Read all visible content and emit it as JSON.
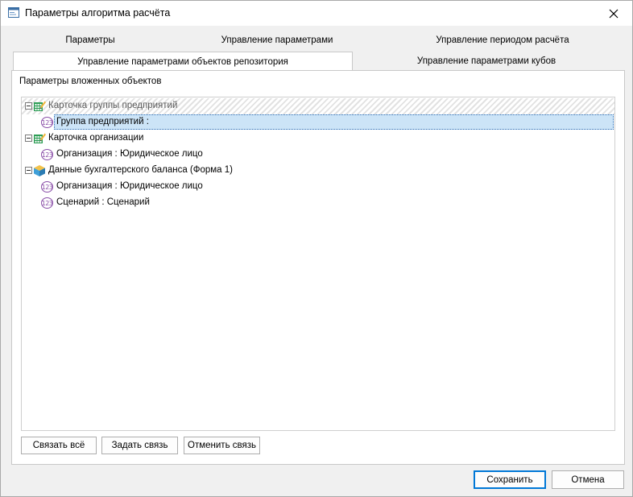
{
  "window": {
    "title": "Параметры алгоритма расчёта"
  },
  "tabs": {
    "row1": [
      {
        "label": "Параметры"
      },
      {
        "label": "Управление параметрами"
      },
      {
        "label": "Управление периодом расчёта"
      }
    ],
    "row2": [
      {
        "label": "Управление параметрами объектов репозитория",
        "active": true
      },
      {
        "label": "Управление параметрами кубов",
        "active": false
      }
    ]
  },
  "panel": {
    "group_label": "Параметры вложенных объектов"
  },
  "tree": {
    "nodes": [
      {
        "label": "Карточка группы предприятий",
        "type": "group",
        "icon": "dictionary-icon",
        "expanded": true,
        "muted": true
      },
      {
        "label": "Группа предприятий :",
        "type": "param",
        "icon": "param-123-icon",
        "selected": true
      },
      {
        "label": "Карточка организации",
        "type": "group",
        "icon": "dictionary-icon",
        "expanded": true
      },
      {
        "label": "Организация : Юридическое лицо",
        "type": "param",
        "icon": "param-123-icon"
      },
      {
        "label": "Данные бухгалтерского баланса (Форма 1)",
        "type": "group",
        "icon": "cube-icon",
        "expanded": true
      },
      {
        "label": "Организация : Юридическое лицо",
        "type": "param",
        "icon": "param-123-icon"
      },
      {
        "label": "Сценарий : Сценарий",
        "type": "param",
        "icon": "param-123-icon"
      }
    ],
    "badge_text": "123"
  },
  "buttons": {
    "link_all": "Связать всё",
    "set_link": "Задать связь",
    "cancel_link": "Отменить связь",
    "save": "Сохранить",
    "cancel": "Отмена"
  },
  "colors": {
    "selection": "#cce4f7",
    "accent": "#0078d7",
    "param_badge": "#8a4fa8"
  }
}
